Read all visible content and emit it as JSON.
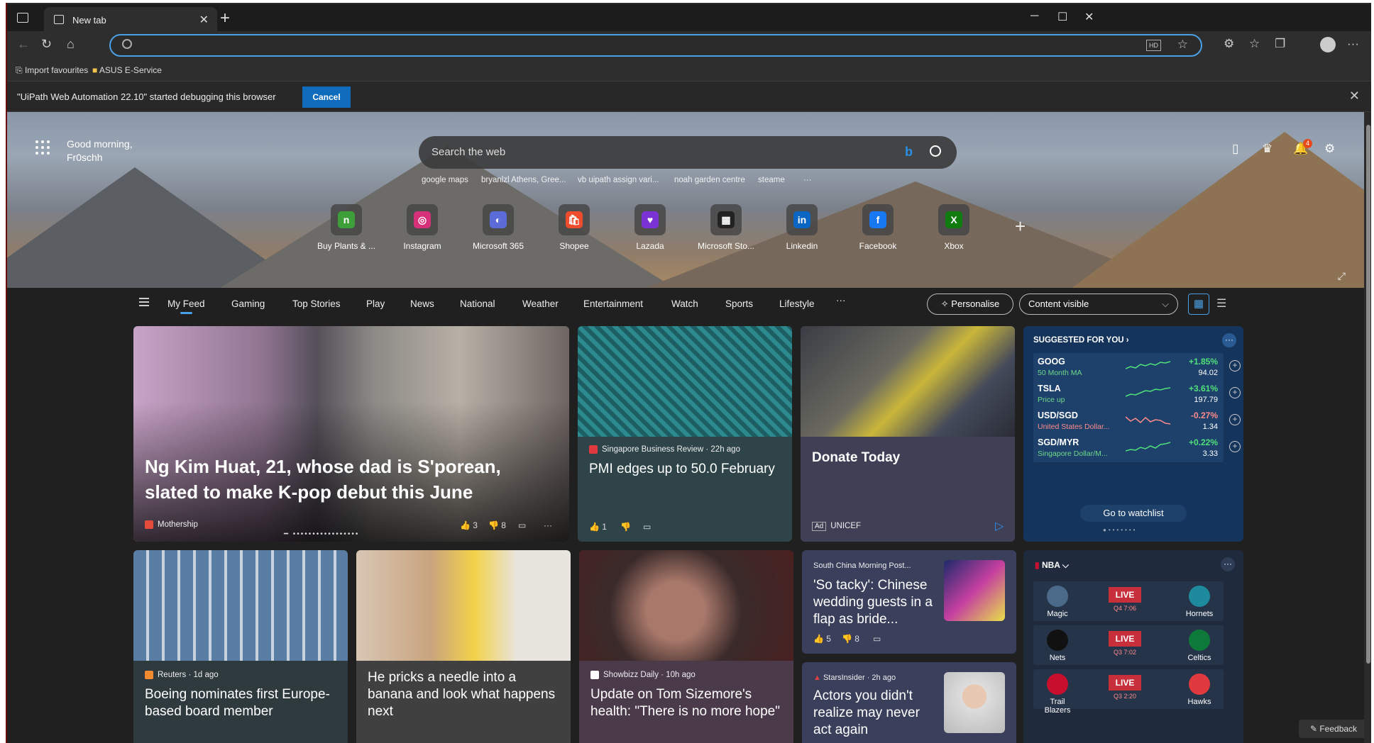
{
  "browser": {
    "tab_title": "New tab",
    "new_tab": "+",
    "window_controls": [
      "─",
      "☐",
      "✕"
    ],
    "favourites": [
      "Import favourites",
      "ASUS E-Service"
    ],
    "infobar": {
      "message": "\"UiPath Web Automation 22.10\" started debugging this browser",
      "cancel": "Cancel"
    }
  },
  "hero": {
    "greeting_line1": "Good morning,",
    "greeting_line2": "Fr0schh",
    "search_placeholder": "Search the web",
    "suggestions": [
      "google maps",
      "bryanlzl Athens, Gree...",
      "vb uipath assign vari...",
      "noah garden centre",
      "steame",
      "···"
    ],
    "notification_count": "4",
    "quick_links": [
      {
        "label": "Buy Plants & ...",
        "glyph": "n",
        "color": "#3e9e3a"
      },
      {
        "label": "Instagram",
        "glyph": "◎",
        "color": "#d6307a"
      },
      {
        "label": "Microsoft 365",
        "glyph": "◐",
        "color": "#5b6bd8"
      },
      {
        "label": "Shopee",
        "glyph": "🛍",
        "color": "#ee4d2d"
      },
      {
        "label": "Lazada",
        "glyph": "♥",
        "color": "#7b32d4"
      },
      {
        "label": "Microsoft Sto...",
        "glyph": "▦",
        "color": "#222222"
      },
      {
        "label": "Linkedin",
        "glyph": "in",
        "color": "#0a66c2"
      },
      {
        "label": "Facebook",
        "glyph": "f",
        "color": "#1877f2"
      },
      {
        "label": "Xbox",
        "glyph": "X",
        "color": "#107c10"
      }
    ]
  },
  "feed_nav": {
    "tabs": [
      "My Feed",
      "Gaming",
      "Top Stories",
      "Play",
      "News",
      "National",
      "Weather",
      "Entertainment",
      "Watch",
      "Sports",
      "Lifestyle",
      "···"
    ],
    "personalise": "Personalise",
    "content_visible": "Content visible"
  },
  "cards": {
    "hero": {
      "headline": "Ng Kim Huat, 21, whose dad is S'porean, slated to make K-pop debut this June",
      "source": "Mothership",
      "likes": "3",
      "dislikes": "8"
    },
    "pmi": {
      "source": "Singapore Business Review · 22h ago",
      "headline": "PMI edges up to 50.0 February",
      "likes": "1"
    },
    "donate": {
      "headline": "Donate Today",
      "ad": "Ad",
      "sponsor": "UNICEF"
    },
    "boeing": {
      "source": "Reuters · 1d ago",
      "headline": "Boeing nominates first Europe-based board member"
    },
    "banana": {
      "headline": "He pricks a needle into a banana and look what happens next"
    },
    "sizemore": {
      "source": "Showbizz Daily · 10h ago",
      "headline": "Update on Tom Sizemore's health: \"There is no more hope\""
    },
    "wedding": {
      "source": "South China Morning Post...",
      "headline": "'So tacky': Chinese wedding guests in a flap as bride...",
      "likes": "5",
      "dislikes": "8"
    },
    "actors": {
      "source": "StarsInsider · 2h ago",
      "headline": "Actors you didn't realize may never act again"
    }
  },
  "stocks": {
    "title": "SUGGESTED FOR YOU",
    "items": [
      {
        "symbol": "GOOG",
        "sub": "50 Month MA",
        "change": "+1.85%",
        "value": "94.02",
        "color": "#4fe07a",
        "trend": [
          6,
          9,
          7,
          12,
          10,
          13,
          11,
          15,
          14,
          16
        ]
      },
      {
        "symbol": "TSLA",
        "sub": "Price up",
        "change": "+3.61%",
        "value": "197.79",
        "color": "#4fe07a",
        "trend": [
          5,
          8,
          7,
          10,
          13,
          12,
          15,
          14,
          16,
          17
        ]
      },
      {
        "symbol": "USD/SGD",
        "sub": "United States Dollar...",
        "change": "-0.27%",
        "value": "1.34",
        "color": "#ff8a8a",
        "trend": [
          14,
          8,
          12,
          6,
          13,
          7,
          10,
          9,
          5,
          4
        ]
      },
      {
        "symbol": "SGD/MYR",
        "sub": "Singapore Dollar/M...",
        "change": "+0.22%",
        "value": "3.33",
        "color": "#4fe07a",
        "trend": [
          4,
          6,
          5,
          9,
          7,
          11,
          8,
          13,
          14,
          16
        ]
      }
    ],
    "watchlist": "Go to watchlist"
  },
  "nba": {
    "title": "NBA",
    "games": [
      {
        "home": "Magic",
        "away": "Hornets",
        "status": "LIVE",
        "time": "Q4 7:06",
        "home_color": "#4b6a8a",
        "away_color": "#1d8a9e"
      },
      {
        "home": "Nets",
        "away": "Celtics",
        "status": "LIVE",
        "time": "Q3 7:02",
        "home_color": "#111111",
        "away_color": "#0d7a3a"
      },
      {
        "home": "Trail Blazers",
        "away": "Hawks",
        "status": "LIVE",
        "time": "Q3 2:20",
        "home_color": "#c8102e",
        "away_color": "#e03a3e"
      }
    ]
  },
  "feedback": "Feedback"
}
